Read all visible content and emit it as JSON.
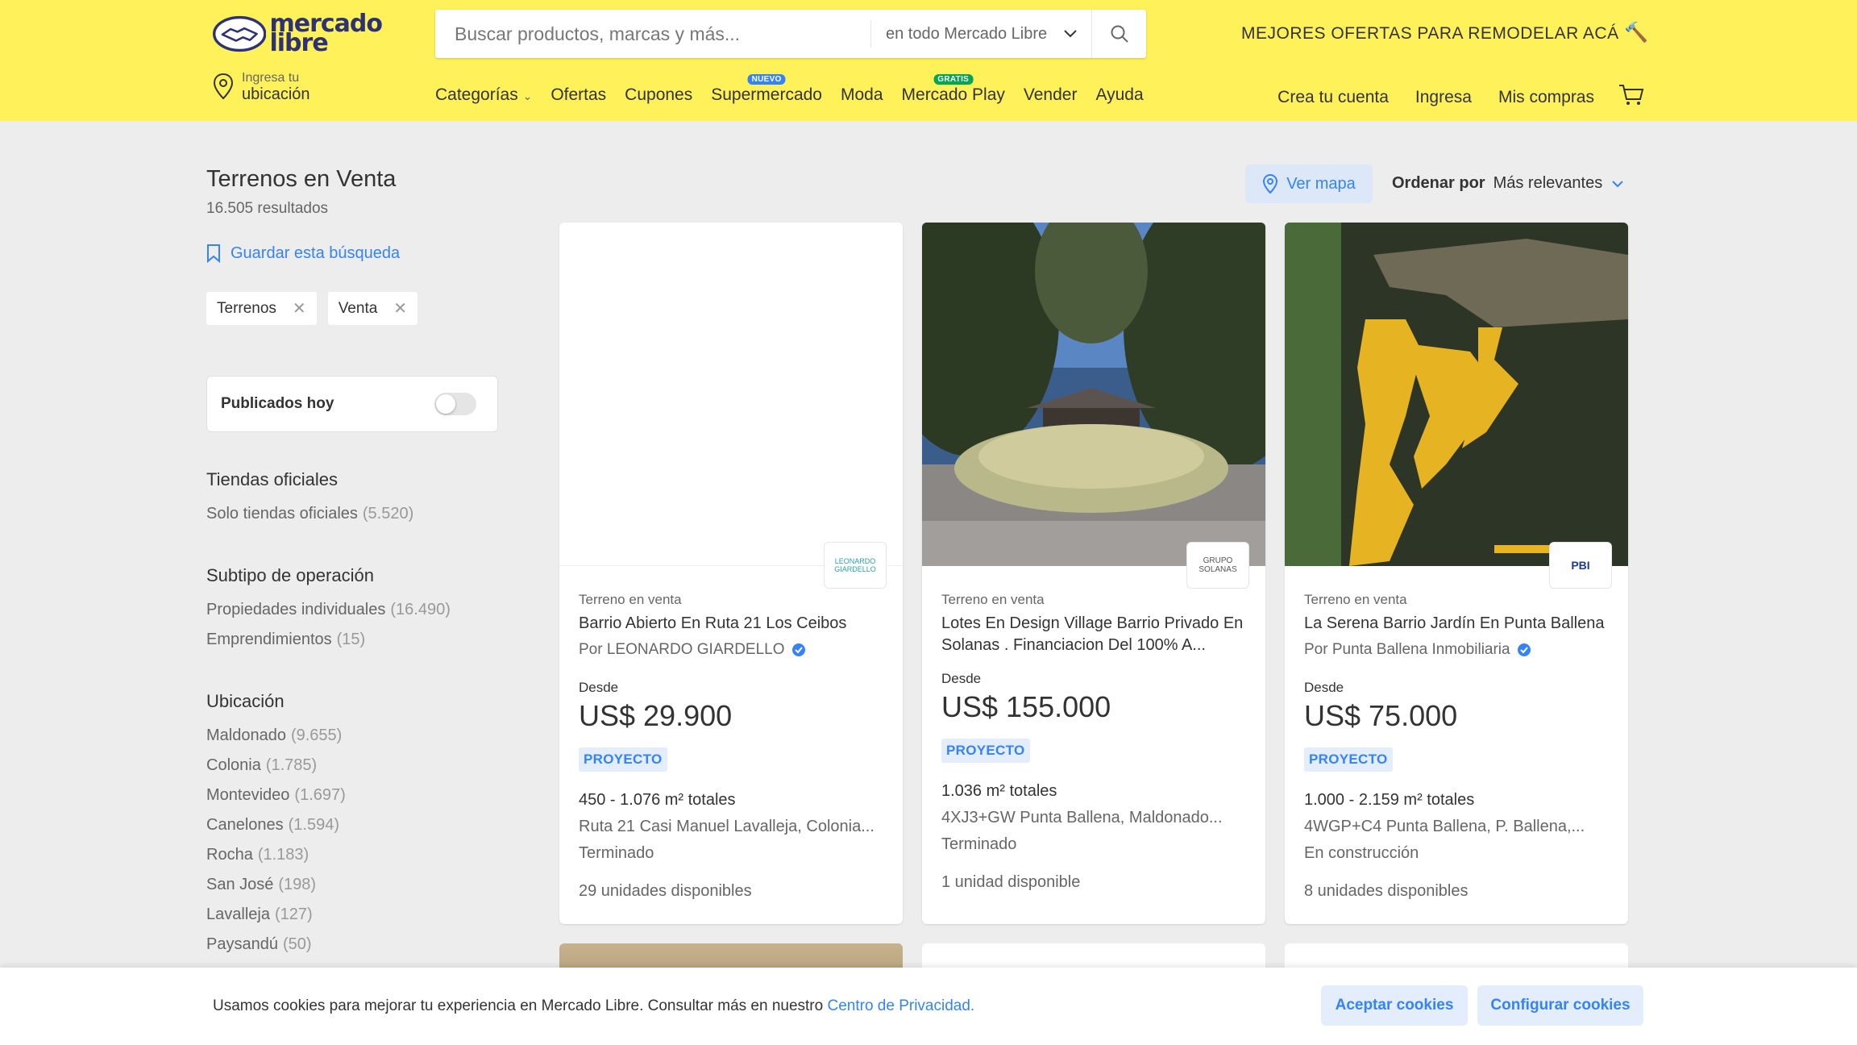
{
  "header": {
    "logo_text": "mercado\nlibre",
    "search_placeholder": "Buscar productos, marcas y más...",
    "search_scope": "en todo Mercado Libre",
    "promo": "MEJORES OFERTAS PARA REMODELAR ACÁ",
    "location_line1": "Ingresa tu",
    "location_line2": "ubicación",
    "nav": [
      {
        "label": "Categorías",
        "badge": ""
      },
      {
        "label": "Ofertas",
        "badge": ""
      },
      {
        "label": "Cupones",
        "badge": ""
      },
      {
        "label": "Supermercado",
        "badge": "NUEVO",
        "badge_color": "#3483fa"
      },
      {
        "label": "Moda",
        "badge": ""
      },
      {
        "label": "Mercado Play",
        "badge": "GRATIS",
        "badge_color": "#00a650"
      },
      {
        "label": "Vender",
        "badge": ""
      },
      {
        "label": "Ayuda",
        "badge": ""
      }
    ],
    "user_nav": [
      "Crea tu cuenta",
      "Ingresa",
      "Mis compras"
    ]
  },
  "sidebar": {
    "title": "Terrenos en Venta",
    "results": "16.505 resultados",
    "save_search": "Guardar esta búsqueda",
    "chips": [
      "Terrenos",
      "Venta"
    ],
    "toggle_label": "Publicados hoy",
    "facets": [
      {
        "title": "Tiendas oficiales",
        "options": [
          {
            "label": "Solo tiendas oficiales",
            "count": "(5.520)"
          }
        ]
      },
      {
        "title": "Subtipo de operación",
        "options": [
          {
            "label": "Propiedades individuales",
            "count": "(16.490)"
          },
          {
            "label": "Emprendimientos",
            "count": "(15)"
          }
        ]
      },
      {
        "title": "Ubicación",
        "options": [
          {
            "label": "Maldonado",
            "count": "(9.655)"
          },
          {
            "label": "Colonia",
            "count": "(1.785)"
          },
          {
            "label": "Montevideo",
            "count": "(1.697)"
          },
          {
            "label": "Canelones",
            "count": "(1.594)"
          },
          {
            "label": "Rocha",
            "count": "(1.183)"
          },
          {
            "label": "San José",
            "count": "(198)"
          },
          {
            "label": "Lavalleja",
            "count": "(127)"
          },
          {
            "label": "Paysandú",
            "count": "(50)"
          }
        ]
      }
    ]
  },
  "toolbar": {
    "map_button": "Ver mapa",
    "order_label": "Ordenar por",
    "order_value": "Más relevantes"
  },
  "cards": [
    {
      "type": "Terreno en venta",
      "name": "Barrio Abierto En Ruta 21 Los Ceibos",
      "by": "Por LEONARDO GIARDELLO",
      "desde": "Desde",
      "price": "US$ 29.900",
      "tag": "PROYECTO",
      "area": "450 - 1.076 m² totales",
      "address": "Ruta 21 Casi Manuel Lavalleja, Colonia...",
      "status": "Terminado",
      "units": "29 unidades disponibles",
      "logo_text": "LEONARDO GIARDELLO"
    },
    {
      "type": "Terreno en venta",
      "name": "Lotes En Design Village Barrio Privado En Solanas . Financiacion Del 100% A...",
      "by": "",
      "desde": "Desde",
      "price": "US$ 155.000",
      "tag": "PROYECTO",
      "area": "1.036 m² totales",
      "address": "4XJ3+GW Punta Ballena, Maldonado...",
      "status": "Terminado",
      "units": "1 unidad disponible",
      "logo_text": "GRUPO SOLANAS"
    },
    {
      "type": "Terreno en venta",
      "name": "La Serena Barrio Jardín En Punta Ballena",
      "by": "Por Punta Ballena Inmobiliaria",
      "desde": "Desde",
      "price": "US$ 75.000",
      "tag": "PROYECTO",
      "area": "1.000 - 2.159 m² totales",
      "address": "4WGP+C4 Punta Ballena, P. Ballena,...",
      "status": "En construcción",
      "units": "8 unidades disponibles",
      "logo_text": "PBI"
    }
  ],
  "cookie": {
    "text": "Usamos cookies para mejorar tu experiencia en Mercado Libre. Consultar más en nuestro",
    "link": "Centro de Privacidad.",
    "accept": "Aceptar cookies",
    "configure": "Configurar cookies"
  },
  "colors": {
    "brand_yellow": "#fff159",
    "accent_blue": "#3483fa",
    "background": "#ededed"
  }
}
